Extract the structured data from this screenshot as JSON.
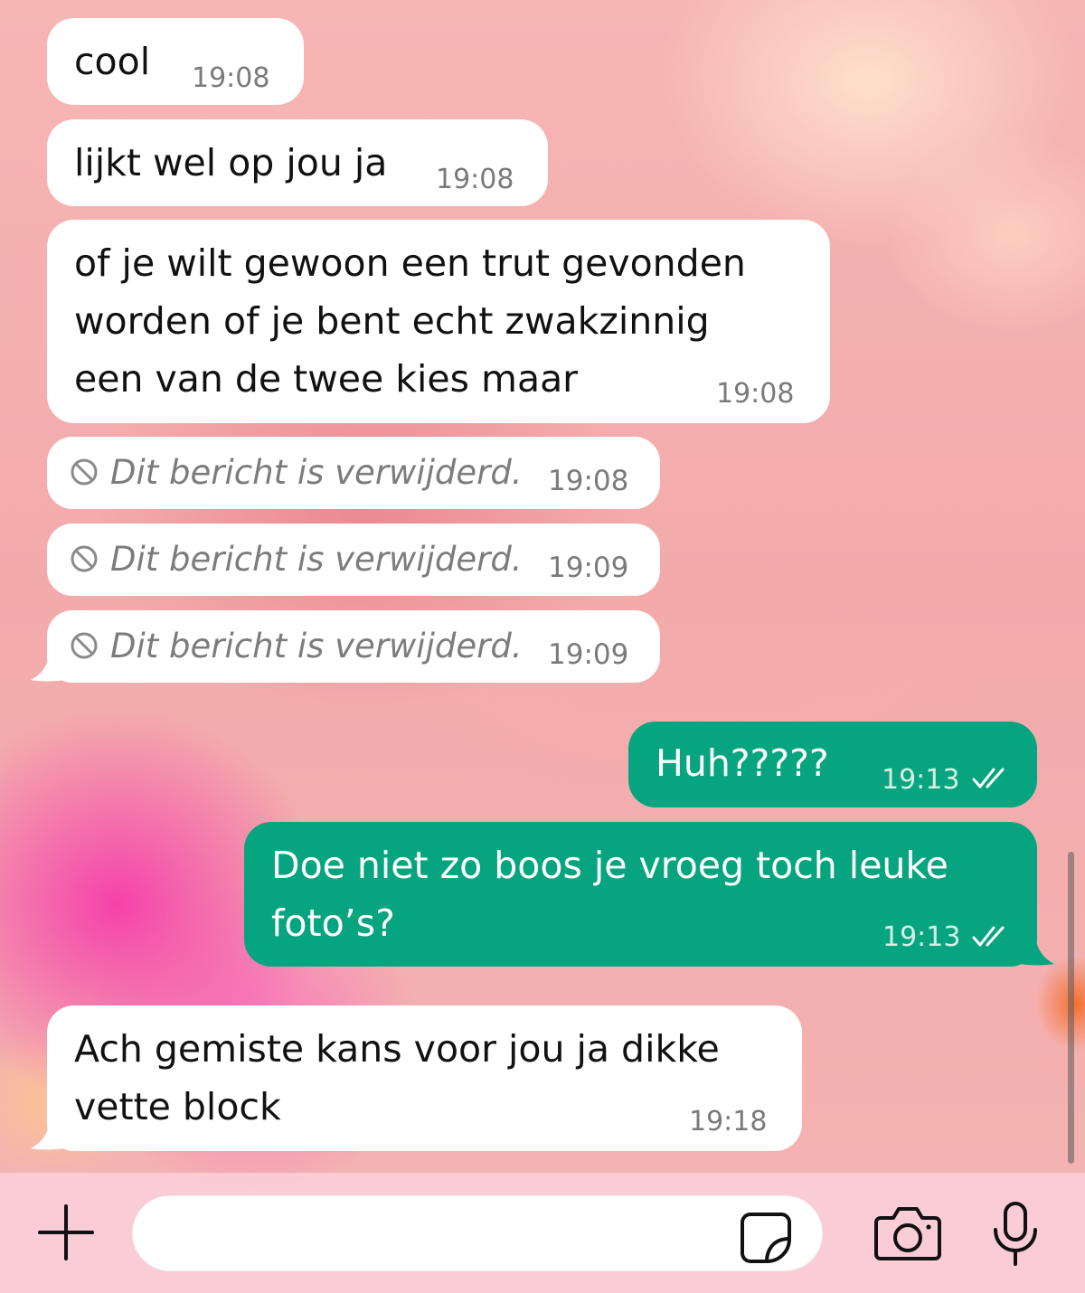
{
  "messages": [
    {
      "text": "cool",
      "time": "19:08"
    },
    {
      "text": "lijkt wel op jou ja",
      "time": "19:08"
    },
    {
      "text": "of je wilt gewoon een trut gevonden\nworden of je bent echt zwakzinnig\neen van de twee kies maar",
      "time": "19:08"
    },
    {
      "text": "Dit bericht is verwijderd.",
      "time": "19:08"
    },
    {
      "text": "Dit bericht is verwijderd.",
      "time": "19:09"
    },
    {
      "text": "Dit bericht is verwijderd.",
      "time": "19:09"
    },
    {
      "text": "Huh?????",
      "time": "19:13"
    },
    {
      "text": "Doe niet zo boos je vroeg toch leuke\nfoto’s?",
      "time": "19:13"
    },
    {
      "text": "Ach gemiste kans voor jou ja dikke\nvette block",
      "time": "19:18"
    }
  ],
  "input_bar": {
    "message_value": "",
    "icons": [
      "plus-icon",
      "sticker-icon",
      "camera-icon",
      "microphone-icon"
    ]
  },
  "colors": {
    "incoming_bubble": "#ffffff",
    "outgoing_bubble": "#06a57f",
    "read_ticks": "#ffffff"
  }
}
